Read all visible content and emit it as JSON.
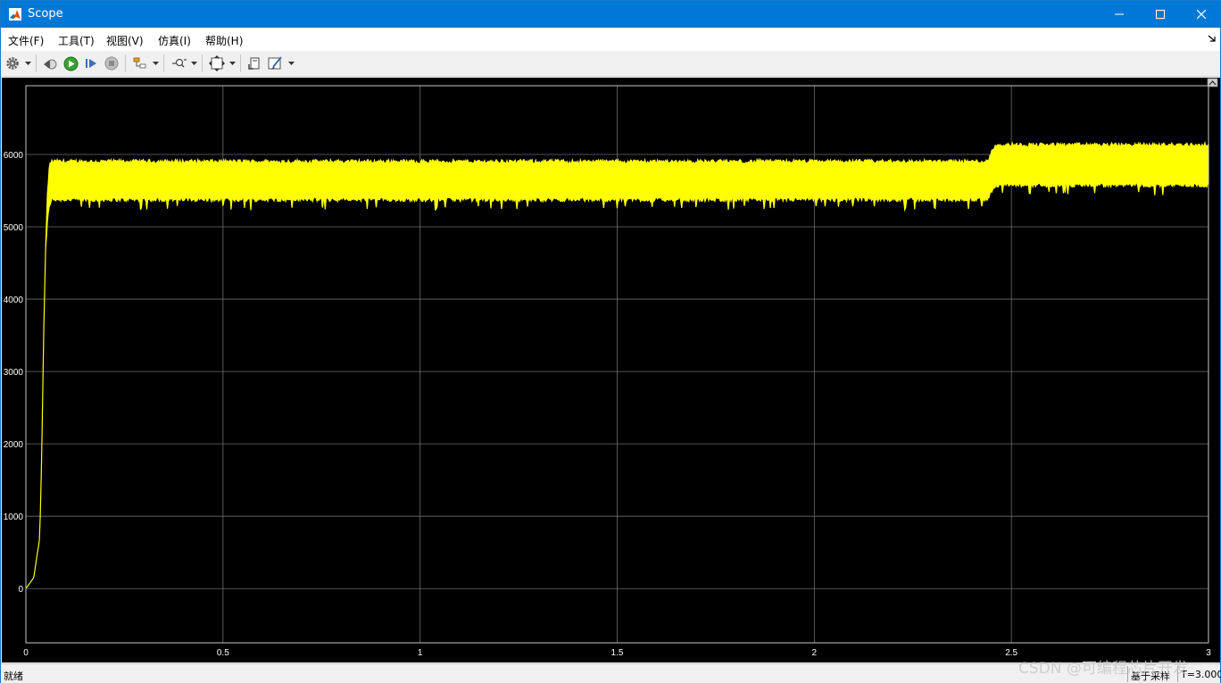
{
  "window": {
    "title": "Scope"
  },
  "menu": [
    {
      "label": "文件(F)",
      "name": "menu-file"
    },
    {
      "label": "工具(T)",
      "name": "menu-tools"
    },
    {
      "label": "视图(V)",
      "name": "menu-view"
    },
    {
      "label": "仿真(I)",
      "name": "menu-simulation"
    },
    {
      "label": "帮助(H)",
      "name": "menu-help"
    }
  ],
  "toolbar": {
    "icons": [
      "settings-icon",
      "step-back-icon",
      "run-icon",
      "step-forward-icon",
      "stop-icon",
      "highlight-block-icon",
      "zoom-icon",
      "autoscale-icon",
      "restore-layout-icon",
      "style-icon"
    ]
  },
  "status": {
    "text": "就绪",
    "sample": "基于采样",
    "time": "T=3.000"
  },
  "watermark": "CSDN @可编程芯片开发",
  "colors": {
    "signal": "#ffff00",
    "background": "#000000",
    "grid": "#6e6e6e",
    "axis_text": "#ffffff",
    "titlebar": "#0078d7"
  },
  "chart_data": {
    "type": "line",
    "title": "",
    "xlabel": "",
    "ylabel": "",
    "xlim": [
      0,
      3
    ],
    "ylim": [
      -750,
      6950
    ],
    "xticks": [
      0,
      0.5,
      1,
      1.5,
      2,
      2.5,
      3
    ],
    "xtick_labels": [
      "0",
      "0.5",
      "1",
      "1.5",
      "2",
      "2.5",
      "3"
    ],
    "yticks": [
      0,
      1000,
      2000,
      3000,
      4000,
      5000,
      6000
    ],
    "ytick_labels": [
      "0",
      "1000",
      "2000",
      "3000",
      "4000",
      "5000",
      "6000"
    ],
    "grid": true,
    "series": [
      {
        "color": "#ffff00",
        "envelope": {
          "x": [
            0,
            0.02,
            0.035,
            0.04,
            0.045,
            0.05,
            0.055,
            0.06,
            0.065,
            0.08,
            0.5,
            1.0,
            1.5,
            2.0,
            2.44,
            2.45,
            2.46,
            3.0
          ],
          "upper": [
            0,
            150,
            700,
            1800,
            3500,
            4700,
            5500,
            5850,
            5900,
            5900,
            5900,
            5900,
            5900,
            5900,
            5900,
            6050,
            6130,
            6130
          ],
          "lower": [
            0,
            150,
            700,
            1800,
            3500,
            4700,
            5100,
            5300,
            5380,
            5380,
            5380,
            5380,
            5380,
            5380,
            5380,
            5500,
            5580,
            5580
          ]
        }
      }
    ]
  }
}
